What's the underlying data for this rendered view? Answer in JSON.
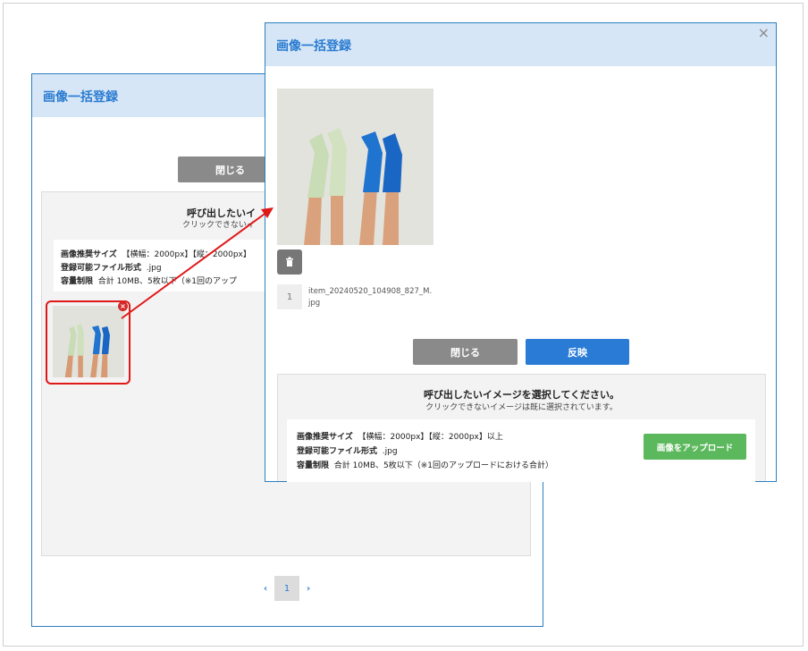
{
  "back_dialog": {
    "title": "画像一括登録",
    "close_label": "閉じる",
    "select_title": "呼び出したいイ",
    "select_sub": "クリックできないイ",
    "info": {
      "size_label": "画像推奨サイズ",
      "size_value": "【横幅：2000px】【縦：2000px】",
      "format_label": "登録可能ファイル形式",
      "format_value": ".jpg",
      "limit_label": "容量制限",
      "limit_value": "合計 10MB、5枚以下（※1回のアップ"
    },
    "pagination": {
      "prev": "‹",
      "current": "1",
      "next": "›"
    }
  },
  "front_dialog": {
    "title": "画像一括登録",
    "close_x": "×",
    "trash_icon": "trash-icon",
    "item_number": "1",
    "file_name": "item_20240520_104908_827_M.jpg",
    "close_label": "閉じる",
    "apply_label": "反映",
    "select_title": "呼び出したいイメージを選択してください。",
    "select_sub": "クリックできないイメージは既に選択されています。",
    "info": {
      "size_label": "画像推奨サイズ",
      "size_value": "【横幅：2000px】【縦：2000px】以上",
      "format_label": "登録可能ファイル形式",
      "format_value": ".jpg",
      "limit_label": "容量制限",
      "limit_value": "合計 10MB、5枚以下（※1回のアップロードにおける合計）"
    },
    "upload_label": "画像をアップロード"
  },
  "colors": {
    "accent": "#2a7bd6",
    "highlight": "#e01818",
    "upload": "#5cb85c",
    "header_bg": "#d6e6f7"
  }
}
